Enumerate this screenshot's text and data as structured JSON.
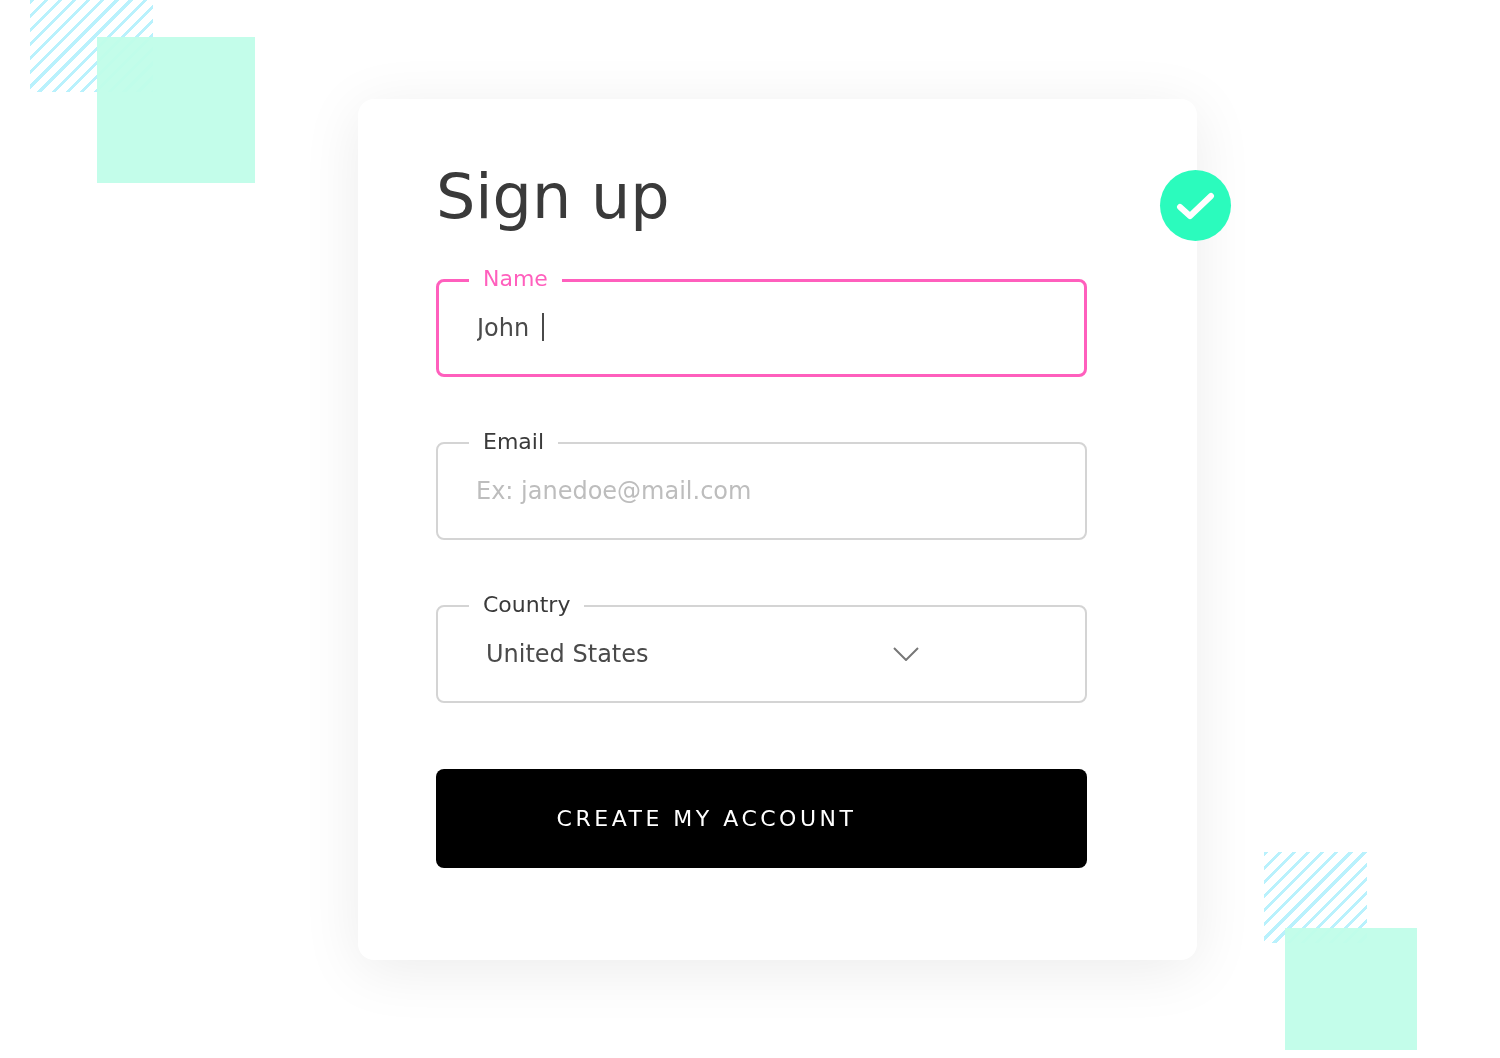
{
  "title": "Sign up",
  "status": {
    "kind": "success"
  },
  "fields": [
    {
      "kind": "text",
      "label": "Name",
      "value": "John",
      "focused": true
    },
    {
      "kind": "text",
      "label": "Email",
      "placeholder": "Ex: janedoe@mail.com",
      "focused": false
    },
    {
      "kind": "select",
      "label": "Country",
      "value": "United States",
      "focused": false
    }
  ],
  "submit": {
    "label": "CREATE MY ACCOUNT"
  }
}
